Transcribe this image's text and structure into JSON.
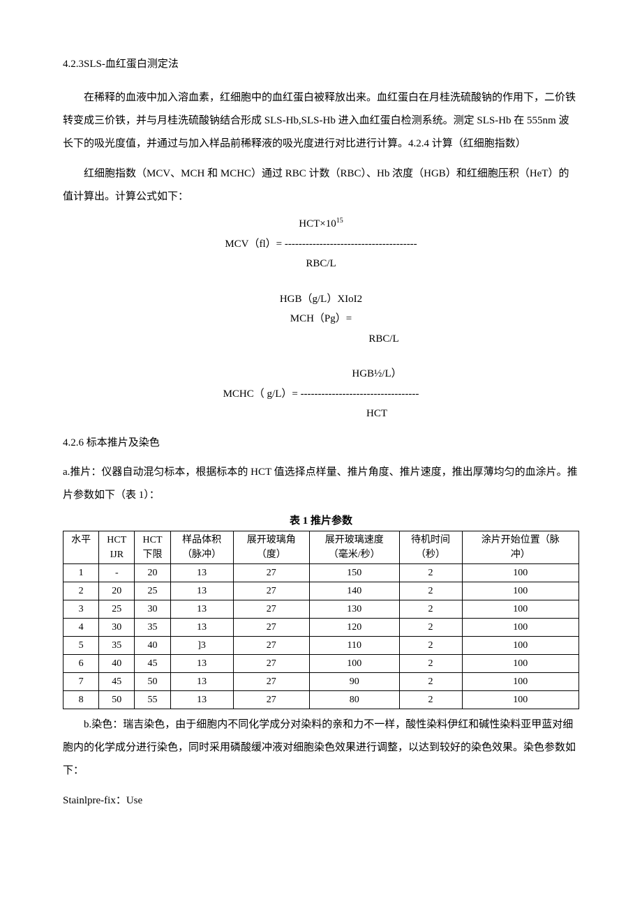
{
  "heading1": "4.2.3SLS-血红蛋白测定法",
  "para1": "在稀释的血液中加入溶血素，红细胞中的血红蛋白被释放出来。血红蛋白在月桂洗硫酸钠的作用下，二价铁转变成三价铁，并与月桂洗硫酸钠结合形成 SLS-Hb,SLS-Hb 进入血红蛋白检测系统。测定 SLS-Hb 在 555nm 波长下的吸光度值，并通过与加入样品前稀释液的吸光度进行对比进行计算。4.2.4 计算（红细胞指数）",
  "para2": "红细胞指数（MCV、MCH 和 MCHC）通过 RBC 计数（RBC）、Hb 浓度（HGB）和红细胞压积（HeT）的值计算出。计算公式如下：",
  "formula1": {
    "top": "HCT×10",
    "sup": "15",
    "mid": "MCV（fl）= --------------------------------------",
    "bot": "RBC/L"
  },
  "formula2": {
    "top": "HGB（g/L）XIoI2",
    "mid": "MCH（Pg）=",
    "bot": "RBC/L"
  },
  "formula3": {
    "top": "HGB½/L）",
    "mid": "MCHC（ g/L）= ----------------------------------",
    "bot": "HCT"
  },
  "heading2": "4.2.6 标本推片及染色",
  "para3": "a.推片：仪器自动混匀标本，根据标本的 HCT 值选择点样量、推片角度、推片速度，推出厚薄均匀的血涂片。推片参数如下（表 1）：",
  "tableTitle": "表 1 推片参数",
  "table": {
    "headers": [
      {
        "l1": "水平",
        "l2": ""
      },
      {
        "l1": "HCT",
        "l2": "IJR"
      },
      {
        "l1": "HCT",
        "l2": "下限"
      },
      {
        "l1": "样品体积",
        "l2": "（脉冲）"
      },
      {
        "l1": "展开玻璃角",
        "l2": "（度）"
      },
      {
        "l1": "展开玻璃速度",
        "l2": "（毫米/秒）"
      },
      {
        "l1": "待机时间",
        "l2": "（秒）"
      },
      {
        "l1": "涂片开始位置（脉",
        "l2": "冲）"
      }
    ],
    "rows": [
      [
        "1",
        "-",
        "20",
        "13",
        "27",
        "150",
        "2",
        "100"
      ],
      [
        "2",
        "20",
        "25",
        "13",
        "27",
        "140",
        "2",
        "100"
      ],
      [
        "3",
        "25",
        "30",
        "13",
        "27",
        "130",
        "2",
        "100"
      ],
      [
        "4",
        "30",
        "35",
        "13",
        "27",
        "120",
        "2",
        "100"
      ],
      [
        "5",
        "35",
        "40",
        "]3",
        "27",
        "110",
        "2",
        "100"
      ],
      [
        "6",
        "40",
        "45",
        "13",
        "27",
        "100",
        "2",
        "100"
      ],
      [
        "7",
        "45",
        "50",
        "13",
        "27",
        "90",
        "2",
        "100"
      ],
      [
        "8",
        "50",
        "55",
        "13",
        "27",
        "80",
        "2",
        "100"
      ]
    ]
  },
  "para4": "b.染色：瑞吉染色，由于细胞内不同化学成分对染料的亲和力不一样，酸性染料伊红和碱性染料亚甲蓝对细胞内的化学成分进行染色，同时采用磷酸缓冲液对细胞染色效果进行调整，以达到较好的染色效果。染色参数如下：",
  "para5": "Stainlpre-fix：Use"
}
